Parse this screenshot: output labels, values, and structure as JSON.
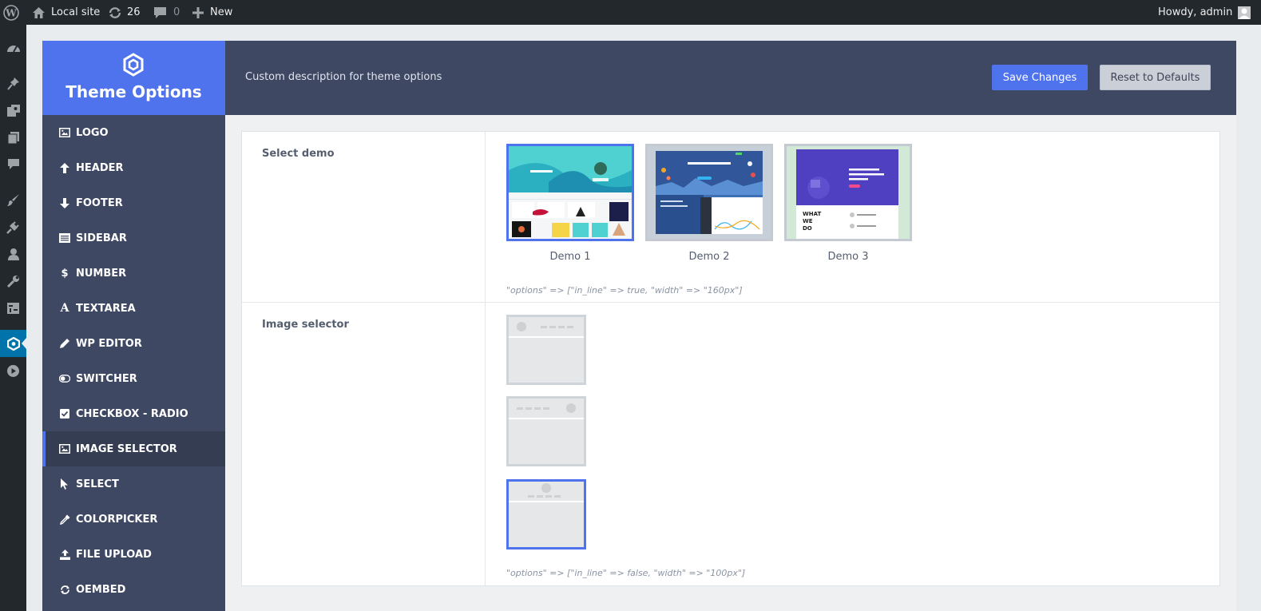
{
  "admin_bar": {
    "site_name": "Local site",
    "updates_count": "26",
    "comments_count": "0",
    "new_label": "New",
    "greeting": "Howdy, admin"
  },
  "admin_menu": {
    "icons": [
      "dashboard-icon",
      "posts-pin-icon",
      "media-icon",
      "pages-icon",
      "comments-icon",
      "appearance-icon",
      "plugins-icon",
      "users-icon",
      "tools-icon",
      "settings-icon",
      "theme-options-icon",
      "video-icon"
    ],
    "current": "theme-options-icon"
  },
  "panel": {
    "brand_title": "Theme Options",
    "description": "Custom description for theme options",
    "save_label": "Save Changes",
    "reset_label": "Reset to Defaults"
  },
  "nav": {
    "items": [
      {
        "label": "LOGO",
        "icon": "image-icon"
      },
      {
        "label": "HEADER",
        "icon": "arrow-up-icon"
      },
      {
        "label": "FOOTER",
        "icon": "arrow-down-icon"
      },
      {
        "label": "SIDEBAR",
        "icon": "list-icon"
      },
      {
        "label": "NUMBER",
        "icon": "dollar-icon"
      },
      {
        "label": "TEXTAREA",
        "icon": "font-icon"
      },
      {
        "label": "WP EDITOR",
        "icon": "pencil-icon"
      },
      {
        "label": "SWITCHER",
        "icon": "toggle-icon"
      },
      {
        "label": "CHECKBOX - RADIO",
        "icon": "checkbox-icon"
      },
      {
        "label": "IMAGE SELECTOR",
        "icon": "image-icon"
      },
      {
        "label": "SELECT",
        "icon": "pointer-icon"
      },
      {
        "label": "COLORPICKER",
        "icon": "eyedropper-icon"
      },
      {
        "label": "FILE UPLOAD",
        "icon": "upload-icon"
      },
      {
        "label": "OEMBED",
        "icon": "refresh-icon"
      }
    ],
    "active": "IMAGE SELECTOR"
  },
  "fields": {
    "select_demo": {
      "label": "Select demo",
      "options": [
        "Demo 1",
        "Demo 2",
        "Demo 3"
      ],
      "selected": "Demo 1",
      "note": "\"options\" => [\"in_line\" => true, \"width\" => \"160px\"]"
    },
    "image_selector": {
      "label": "Image selector",
      "options": [
        "header-logo-left",
        "header-logo-right",
        "header-logo-center"
      ],
      "selected": "header-logo-center",
      "note": "\"options\" => [\"in_line\" => false, \"width\" => \"100px\"]"
    }
  },
  "colors": {
    "accent": "#4f73ec",
    "panel_dark": "#3e4862",
    "admin_bar": "#23282d",
    "admin_menu_current": "#0073aa"
  }
}
